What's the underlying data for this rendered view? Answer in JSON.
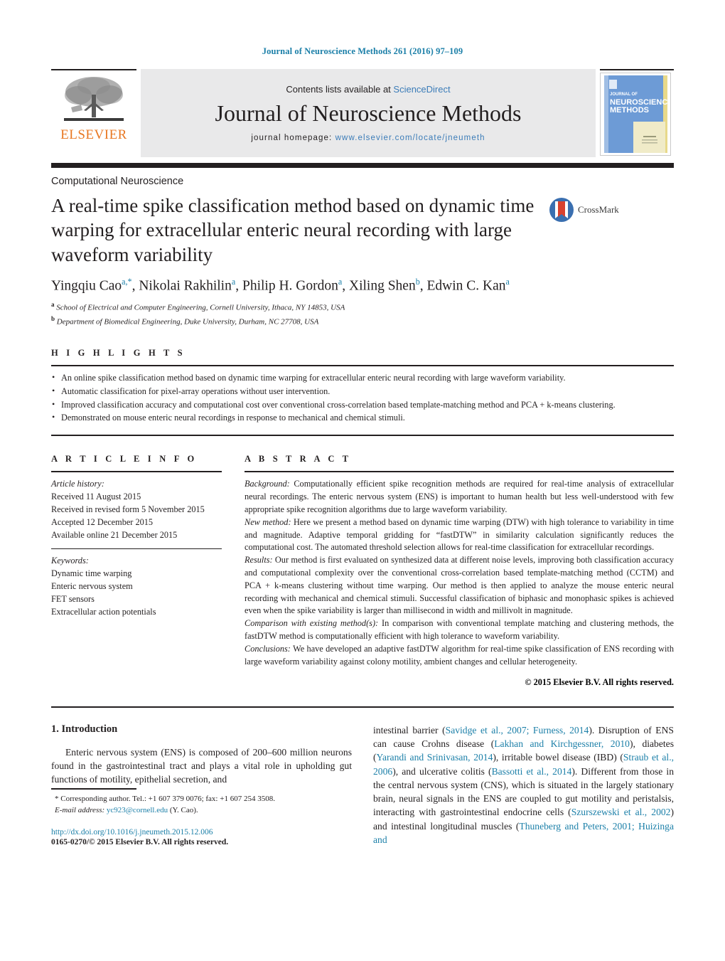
{
  "running_head": "Journal of Neuroscience Methods 261 (2016) 97–109",
  "masthead": {
    "publisher_name": "ELSEVIER",
    "contents_prefix": "Contents lists available at ",
    "contents_link": "ScienceDirect",
    "journal_name": "Journal of Neuroscience Methods",
    "homepage_prefix": "journal homepage: ",
    "homepage_url": "www.elsevier.com/locate/jneumeth",
    "cover_line1": "JOURNAL OF",
    "cover_line2": "NEUROSCIENCE",
    "cover_line3": "METHODS"
  },
  "article": {
    "kicker": "Computational Neuroscience",
    "title": "A real-time spike classification method based on dynamic time warping for extracellular enteric neural recording with large waveform variability",
    "crossmark_label": "CrossMark",
    "authors": [
      {
        "name": "Yingqiu Cao",
        "marks": "a,*"
      },
      {
        "name": "Nikolai Rakhilin",
        "marks": "a"
      },
      {
        "name": "Philip H. Gordon",
        "marks": "a"
      },
      {
        "name": "Xiling Shen",
        "marks": "b"
      },
      {
        "name": "Edwin C. Kan",
        "marks": "a"
      }
    ],
    "affiliations": [
      {
        "mark": "a",
        "text": "School of Electrical and Computer Engineering, Cornell University, Ithaca, NY 14853, USA"
      },
      {
        "mark": "b",
        "text": "Department of Biomedical Engineering, Duke University, Durham, NC 27708, USA"
      }
    ]
  },
  "highlights": {
    "label": "H I G H L I G H T S",
    "items": [
      "An online spike classification method based on dynamic time warping for extracellular enteric neural recording with large waveform variability.",
      "Automatic classification for pixel-array operations without user intervention.",
      "Improved classification accuracy and computational cost over conventional cross-correlation based template-matching method and PCA + k-means clustering.",
      "Demonstrated on mouse enteric neural recordings in response to mechanical and chemical stimuli."
    ]
  },
  "article_info": {
    "label": "A R T I C L E  I N F O",
    "history_heading": "Article history:",
    "history": [
      "Received 11 August 2015",
      "Received in revised form 5 November 2015",
      "Accepted 12 December 2015",
      "Available online 21 December 2015"
    ],
    "keywords_heading": "Keywords:",
    "keywords": [
      "Dynamic time warping",
      "Enteric nervous system",
      "FET sensors",
      "Extracellular action potentials"
    ]
  },
  "abstract": {
    "label": "A B S T R A C T",
    "sections": [
      {
        "lead": "Background:",
        "text": " Computationally efficient spike recognition methods are required for real-time analysis of extracellular neural recordings. The enteric nervous system (ENS) is important to human health but less well-understood with few appropriate spike recognition algorithms due to large waveform variability."
      },
      {
        "lead": "New method:",
        "text": " Here we present a method based on dynamic time warping (DTW) with high tolerance to variability in time and magnitude. Adaptive temporal gridding for “fastDTW” in similarity calculation significantly reduces the computational cost. The automated threshold selection allows for real-time classification for extracellular recordings."
      },
      {
        "lead": "Results:",
        "text": " Our method is first evaluated on synthesized data at different noise levels, improving both classification accuracy and computational complexity over the conventional cross-correlation based template-matching method (CCTM) and PCA + k-means clustering without time warping. Our method is then applied to analyze the mouse enteric neural recording with mechanical and chemical stimuli. Successful classification of biphasic and monophasic spikes is achieved even when the spike variability is larger than millisecond in width and millivolt in magnitude."
      },
      {
        "lead": "Comparison with existing method(s):",
        "text": " In comparison with conventional template matching and clustering methods, the fastDTW method is computationally efficient with high tolerance to waveform variability."
      },
      {
        "lead": "Conclusions:",
        "text": " We have developed an adaptive fastDTW algorithm for real-time spike classification of ENS recording with large waveform variability against colony motility, ambient changes and cellular heterogeneity."
      }
    ],
    "copyright": "© 2015 Elsevier B.V. All rights reserved."
  },
  "introduction": {
    "heading": "1.  Introduction",
    "left_paragraph": "Enteric nervous system (ENS) is composed of 200–600 million neurons found in the gastrointestinal tract and plays a vital role in upholding gut functions of motility, epithelial secretion, and",
    "right_parts": [
      {
        "t": "text",
        "v": "intestinal barrier ("
      },
      {
        "t": "cite",
        "v": "Savidge et al., 2007; Furness, 2014"
      },
      {
        "t": "text",
        "v": "). Disruption of ENS can cause Crohns disease ("
      },
      {
        "t": "cite",
        "v": "Lakhan and Kirchgessner, 2010"
      },
      {
        "t": "text",
        "v": "), diabetes ("
      },
      {
        "t": "cite",
        "v": "Yarandi and Srinivasan, 2014"
      },
      {
        "t": "text",
        "v": "), irritable bowel disease (IBD) ("
      },
      {
        "t": "cite",
        "v": "Straub et al., 2006"
      },
      {
        "t": "text",
        "v": "), and ulcerative colitis ("
      },
      {
        "t": "cite",
        "v": "Bassotti et al., 2014"
      },
      {
        "t": "text",
        "v": "). Different from those in the central nervous system (CNS), which is situated in the largely stationary brain, neural signals in the ENS are coupled to gut motility and peristalsis, interacting with gastrointestinal endocrine cells ("
      },
      {
        "t": "cite",
        "v": "Szurszewski et al., 2002"
      },
      {
        "t": "text",
        "v": ") and intestinal longitudinal muscles ("
      },
      {
        "t": "cite",
        "v": "Thuneberg and Peters, 2001; Huizinga and"
      }
    ]
  },
  "footnotes": {
    "corresponding": "*  Corresponding author. Tel.: +1 607 379 0076; fax: +1 607 254 3508.",
    "email_label": "E-mail address:",
    "email": "yc923@cornell.edu",
    "email_suffix": " (Y. Cao).",
    "doi": "http://dx.doi.org/10.1016/j.jneumeth.2015.12.006",
    "issn": "0165-0270/© 2015 Elsevier B.V. All rights reserved."
  },
  "colors": {
    "link_blue": "#1b7fa8",
    "sd_blue": "#3b7cb8",
    "elsevier_orange": "#e87722",
    "rule_black": "#231f20"
  }
}
